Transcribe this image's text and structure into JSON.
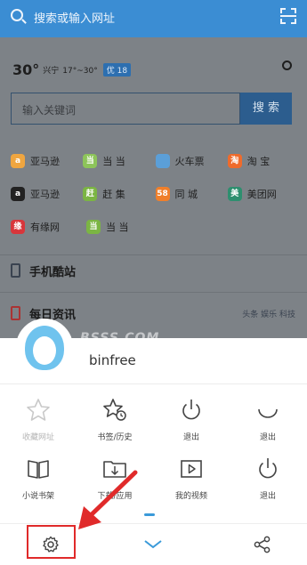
{
  "address_bar": {
    "placeholder": "搜索或输入网址"
  },
  "weather": {
    "temp": "30°",
    "city": "兴宁",
    "range": "17°~30°",
    "aqi": "优 18"
  },
  "search_box": {
    "placeholder": "输入关键词",
    "button": "搜 索"
  },
  "quick_links": [
    [
      {
        "label": "亚马逊",
        "color": "#f0a640",
        "glyph": "a"
      },
      {
        "label": "当 当",
        "color": "#8dc45a",
        "glyph": "当"
      },
      {
        "label": "火车票",
        "color": "#5b9fd8",
        "glyph": ""
      },
      {
        "label": "淘 宝",
        "color": "#ef6b2c",
        "glyph": "淘"
      }
    ],
    [
      {
        "label": "亚马逊",
        "color": "#222222",
        "glyph": "a"
      },
      {
        "label": "赶 集",
        "color": "#7bb543",
        "glyph": "赶"
      },
      {
        "label": "同 城",
        "color": "#f07f2a",
        "glyph": "58"
      },
      {
        "label": "美团网",
        "color": "#2e8f6f",
        "glyph": "美"
      }
    ],
    [
      {
        "label": "有缘网",
        "color": "#d8363b",
        "glyph": "缘"
      },
      {
        "label": "当 当",
        "color": "#7bb543",
        "glyph": "当"
      }
    ]
  ],
  "sections": {
    "mobile": "手机酷站",
    "news": "每日资讯",
    "news_right": "头条 娱乐 科技"
  },
  "watermark": "BSSS.COM",
  "user": {
    "name": "binfree"
  },
  "menu_items": [
    [
      {
        "label": "收藏网址",
        "icon": "star-icon",
        "disabled": true
      },
      {
        "label": "书签/历史",
        "icon": "bookmark-history-icon",
        "disabled": false
      },
      {
        "label": "退出",
        "icon": "power-icon",
        "disabled": false
      },
      {
        "label": "退出",
        "icon": "moon-icon",
        "disabled": false
      }
    ],
    [
      {
        "label": "小说书架",
        "icon": "book-icon",
        "disabled": false
      },
      {
        "label": "下载/应用",
        "icon": "download-folder-icon",
        "disabled": false
      },
      {
        "label": "我的视频",
        "icon": "video-icon",
        "disabled": false
      },
      {
        "label": "退出",
        "icon": "power-icon",
        "disabled": false
      }
    ]
  ],
  "bottom_bar": {
    "settings_icon": "gear-icon",
    "collapse_icon": "chevron-down-icon",
    "share_icon": "share-icon"
  },
  "colors": {
    "accent": "#3a9ad9",
    "topbar": "#3b8dd3",
    "highlight": "#e02a2a"
  }
}
